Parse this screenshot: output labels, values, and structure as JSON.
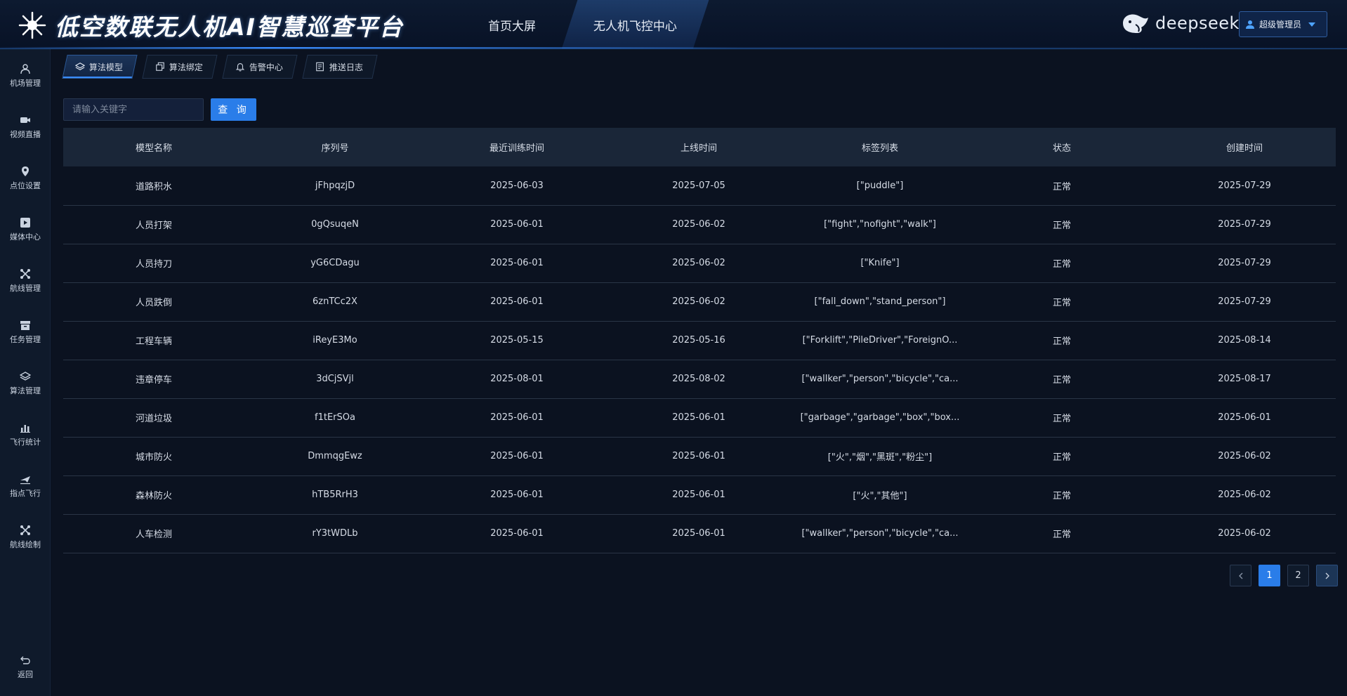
{
  "header": {
    "title": "低空数联无人机AI智慧巡查平台",
    "nav": [
      {
        "label": "首页大屏",
        "active": false
      },
      {
        "label": "无人机飞控中心",
        "active": true
      }
    ],
    "brand": "deepseek",
    "user": "超级管理员"
  },
  "sidebar": {
    "items": [
      {
        "label": "机场管理",
        "icon": "user-icon"
      },
      {
        "label": "视频直播",
        "icon": "video-icon"
      },
      {
        "label": "点位设置",
        "icon": "location-pin-icon"
      },
      {
        "label": "媒体中心",
        "icon": "media-play-icon"
      },
      {
        "label": "航线管理",
        "icon": "drone-icon"
      },
      {
        "label": "任务管理",
        "icon": "archive-box-icon"
      },
      {
        "label": "算法管理",
        "icon": "layers-icon"
      },
      {
        "label": "飞行统计",
        "icon": "bar-chart-icon"
      },
      {
        "label": "指点飞行",
        "icon": "plane-icon"
      },
      {
        "label": "航线绘制",
        "icon": "drone-draw-icon"
      }
    ],
    "back_label": "返回"
  },
  "subtabs": [
    {
      "label": "算法模型",
      "icon": "layers-icon",
      "active": true
    },
    {
      "label": "算法绑定",
      "icon": "copy-icon",
      "active": false
    },
    {
      "label": "告警中心",
      "icon": "bell-icon",
      "active": false
    },
    {
      "label": "推送日志",
      "icon": "log-icon",
      "active": false
    }
  ],
  "search": {
    "placeholder": "请输入关键字",
    "button_label": "查 询"
  },
  "table": {
    "columns": [
      "模型名称",
      "序列号",
      "最近训练时间",
      "上线时间",
      "标签列表",
      "状态",
      "创建时间"
    ],
    "rows": [
      [
        "道路积水",
        "jFhpqzjD",
        "2025-06-03",
        "2025-07-05",
        "[\"puddle\"]",
        "正常",
        "2025-07-29"
      ],
      [
        "人员打架",
        "0gQsuqeN",
        "2025-06-01",
        "2025-06-02",
        "[\"fight\",\"nofight\",\"walk\"]",
        "正常",
        "2025-07-29"
      ],
      [
        "人员持刀",
        "yG6CDagu",
        "2025-06-01",
        "2025-06-02",
        "[\"Knife\"]",
        "正常",
        "2025-07-29"
      ],
      [
        "人员跌倒",
        "6znTCc2X",
        "2025-06-01",
        "2025-06-02",
        "[\"fall_down\",\"stand_person\"]",
        "正常",
        "2025-07-29"
      ],
      [
        "工程车辆",
        "iReyE3Mo",
        "2025-05-15",
        "2025-05-16",
        "[\"Forklift\",\"PileDriver\",\"ForeignO...",
        "正常",
        "2025-08-14"
      ],
      [
        "违章停车",
        "3dCjSVjl",
        "2025-08-01",
        "2025-08-02",
        "[\"wallker\",\"person\",\"bicycle\",\"ca...",
        "正常",
        "2025-08-17"
      ],
      [
        "河道垃圾",
        "f1tErSOa",
        "2025-06-01",
        "2025-06-01",
        "[\"garbage\",\"garbage\",\"box\",\"box...",
        "正常",
        "2025-06-01"
      ],
      [
        "城市防火",
        "DmmqgEwz",
        "2025-06-01",
        "2025-06-01",
        "[\"火\",\"烟\",\"黑斑\",\"粉尘\"]",
        "正常",
        "2025-06-02"
      ],
      [
        "森林防火",
        "hTB5RrH3",
        "2025-06-01",
        "2025-06-01",
        "[\"火\",\"其他\"]",
        "正常",
        "2025-06-02"
      ],
      [
        "人车检测",
        "rY3tWDLb",
        "2025-06-01",
        "2025-06-01",
        "[\"wallker\",\"person\",\"bicycle\",\"ca...",
        "正常",
        "2025-06-02"
      ]
    ]
  },
  "pagination": {
    "pages": [
      "1",
      "2"
    ],
    "current": "1"
  },
  "colors": {
    "accent": "#2a7de9",
    "background": "#0b1220",
    "header_bg": "#081226",
    "table_header_bg": "#1a2638"
  }
}
